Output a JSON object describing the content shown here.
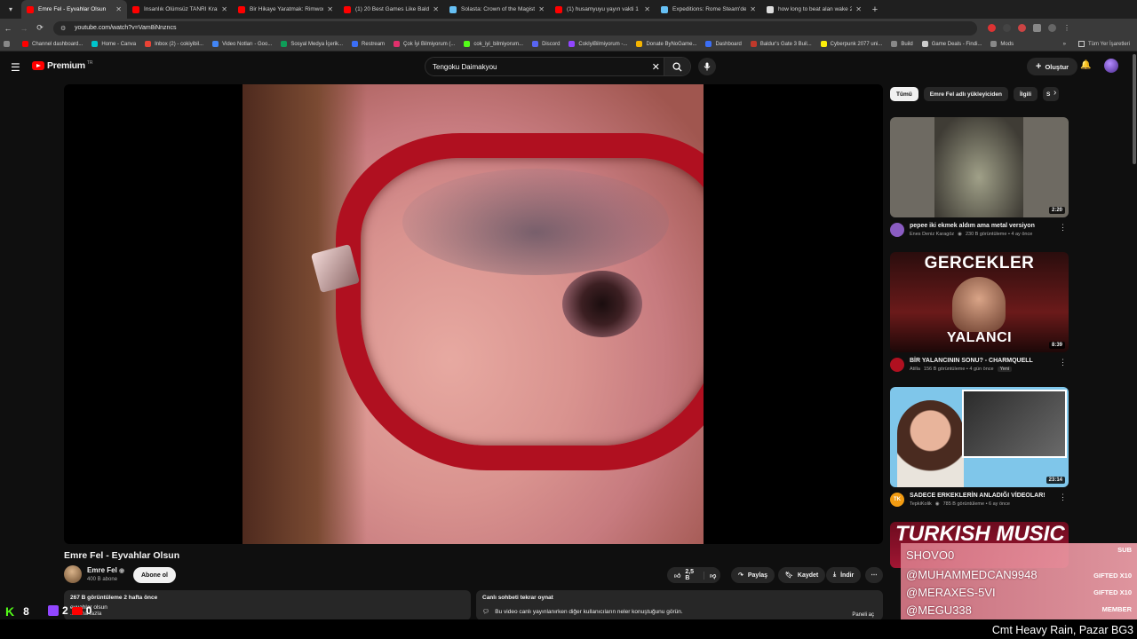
{
  "browser": {
    "tabs": [
      {
        "title": "Emre Fel - Eyvahlar Olsun",
        "color": "#ff0000",
        "active": true
      },
      {
        "title": "İnsanlık Ölümsüz TANRI Kralı A",
        "color": "#ff0000"
      },
      {
        "title": "Bir Hikaye Yaratmak: Rimworld",
        "color": "#ff0000"
      },
      {
        "title": "(1) 20 Best Games Like Baldur's",
        "color": "#ff0000"
      },
      {
        "title": "Solasta: Crown of the Magister",
        "color": "#66c0f4"
      },
      {
        "title": "(1) husamyuyu yayın vakti 1 - Y",
        "color": "#ff0000"
      },
      {
        "title": "Expeditions: Rome Steam'de %",
        "color": "#66c0f4"
      },
      {
        "title": "how long to beat alan wake 2",
        "color": "#dddddd"
      }
    ],
    "url": "youtube.com/watch?v=Vam8iNnzncs",
    "bookmarks": [
      {
        "label": "Channel dashboard...",
        "color": "#ff0000"
      },
      {
        "label": "Home - Canva",
        "color": "#00c4cc"
      },
      {
        "label": "Inbox (2) - cokiyibil...",
        "color": "#ea4335"
      },
      {
        "label": "Video Notları - Goo...",
        "color": "#4285f4"
      },
      {
        "label": "Sosyal Medya İçerik...",
        "color": "#0f9d58"
      },
      {
        "label": "Restream",
        "color": "#3b6ef5"
      },
      {
        "label": "Çok İyi Bilmiyorum (...",
        "color": "#e1306c"
      },
      {
        "label": "cok_iyi_bilmiyorum...",
        "color": "#53fc18"
      },
      {
        "label": "Discord",
        "color": "#5865f2"
      },
      {
        "label": "CokIyiBilmiyorum -...",
        "color": "#9146ff"
      },
      {
        "label": "Donate ByNoGame...",
        "color": "#f5b400"
      },
      {
        "label": "Dashboard",
        "color": "#3b6ef5"
      },
      {
        "label": "Baldur's Gate 3 Buil...",
        "color": "#c0392b"
      },
      {
        "label": "Cyberpunk 2077 uni...",
        "color": "#fcee0a"
      },
      {
        "label": "Build",
        "color": "#888888"
      },
      {
        "label": "Game Deals - Findi...",
        "color": "#cccccc"
      },
      {
        "label": "Mods",
        "color": "#888888"
      }
    ],
    "all_bookmarks": "Tüm Yer İşaretleri"
  },
  "header": {
    "brand": "Premium",
    "brand_sup": "TR",
    "search_value": "Tengoku Daimakyou",
    "create_label": "Oluştur"
  },
  "video": {
    "title": "Emre Fel - Eyvahlar Olsun",
    "channel": "Emre Fel",
    "subscribers": "400 B abone",
    "subscribe_label": "Abone ol",
    "likes": "2,5 B",
    "share_label": "Paylaş",
    "save_label": "Kaydet",
    "download_label": "İndir",
    "views_line": "267 B görüntüleme  2 hafta önce",
    "desc_snippet": "eyvahlar olsun",
    "more_label": "...daha fazla"
  },
  "chat": {
    "header": "Canlı sohbeti tekrar oynat",
    "body": "Bu video canlı yayınlanırken diğer kullanıcıların neler konuştuğunu görün.",
    "panel_label": "Paneli aç"
  },
  "chips": [
    "Tümü",
    "Emre Fel adlı yükleyiciden",
    "İlgili",
    "S"
  ],
  "recommendations": [
    {
      "title": "pepee iki ekmek aldım ama metal versiyon",
      "channel": "Enes Deniz Karagöz",
      "stats": "230 B görüntüleme • 4 ay önce",
      "duration": "2:20",
      "avatar_color": "#8a5cc2"
    },
    {
      "title": "BİR YALANCININ SONU? - CHARMQUELL",
      "channel": "Atilla",
      "stats": "156 B görüntüleme • 4 gün önce",
      "badge": "Yeni",
      "duration": "8:39",
      "avatar_color": "#b01020",
      "thumb_top": "GERCEKLER",
      "thumb_bottom": "YALANCI"
    },
    {
      "title": "SADECE ERKEKLERİN ANLADIĞI VİDEOLAR!",
      "channel": "TepkiKolik",
      "stats": "785 B görüntüleme • 6 ay önce",
      "duration": "23:14",
      "avatar_color": "#f39c12",
      "avatar_text": "TK"
    },
    {
      "thumb_text": "TURKISH MUSIC"
    }
  ],
  "stream_overlay": {
    "events": [
      {
        "name": "SHOVO0",
        "tag": "SUB"
      },
      {
        "name": "@MUHAMMEDCAN9948",
        "tag": "GIFTED X10"
      },
      {
        "name": "@MERAXES-5VI",
        "tag": "GIFTED X10"
      },
      {
        "name": "@MEGU338",
        "tag": "MEMBER"
      }
    ],
    "kick_count": "8",
    "twitch_count": "2",
    "yt_count": "0",
    "ticker": "Cmt Heavy Rain, Pazar BG3"
  }
}
